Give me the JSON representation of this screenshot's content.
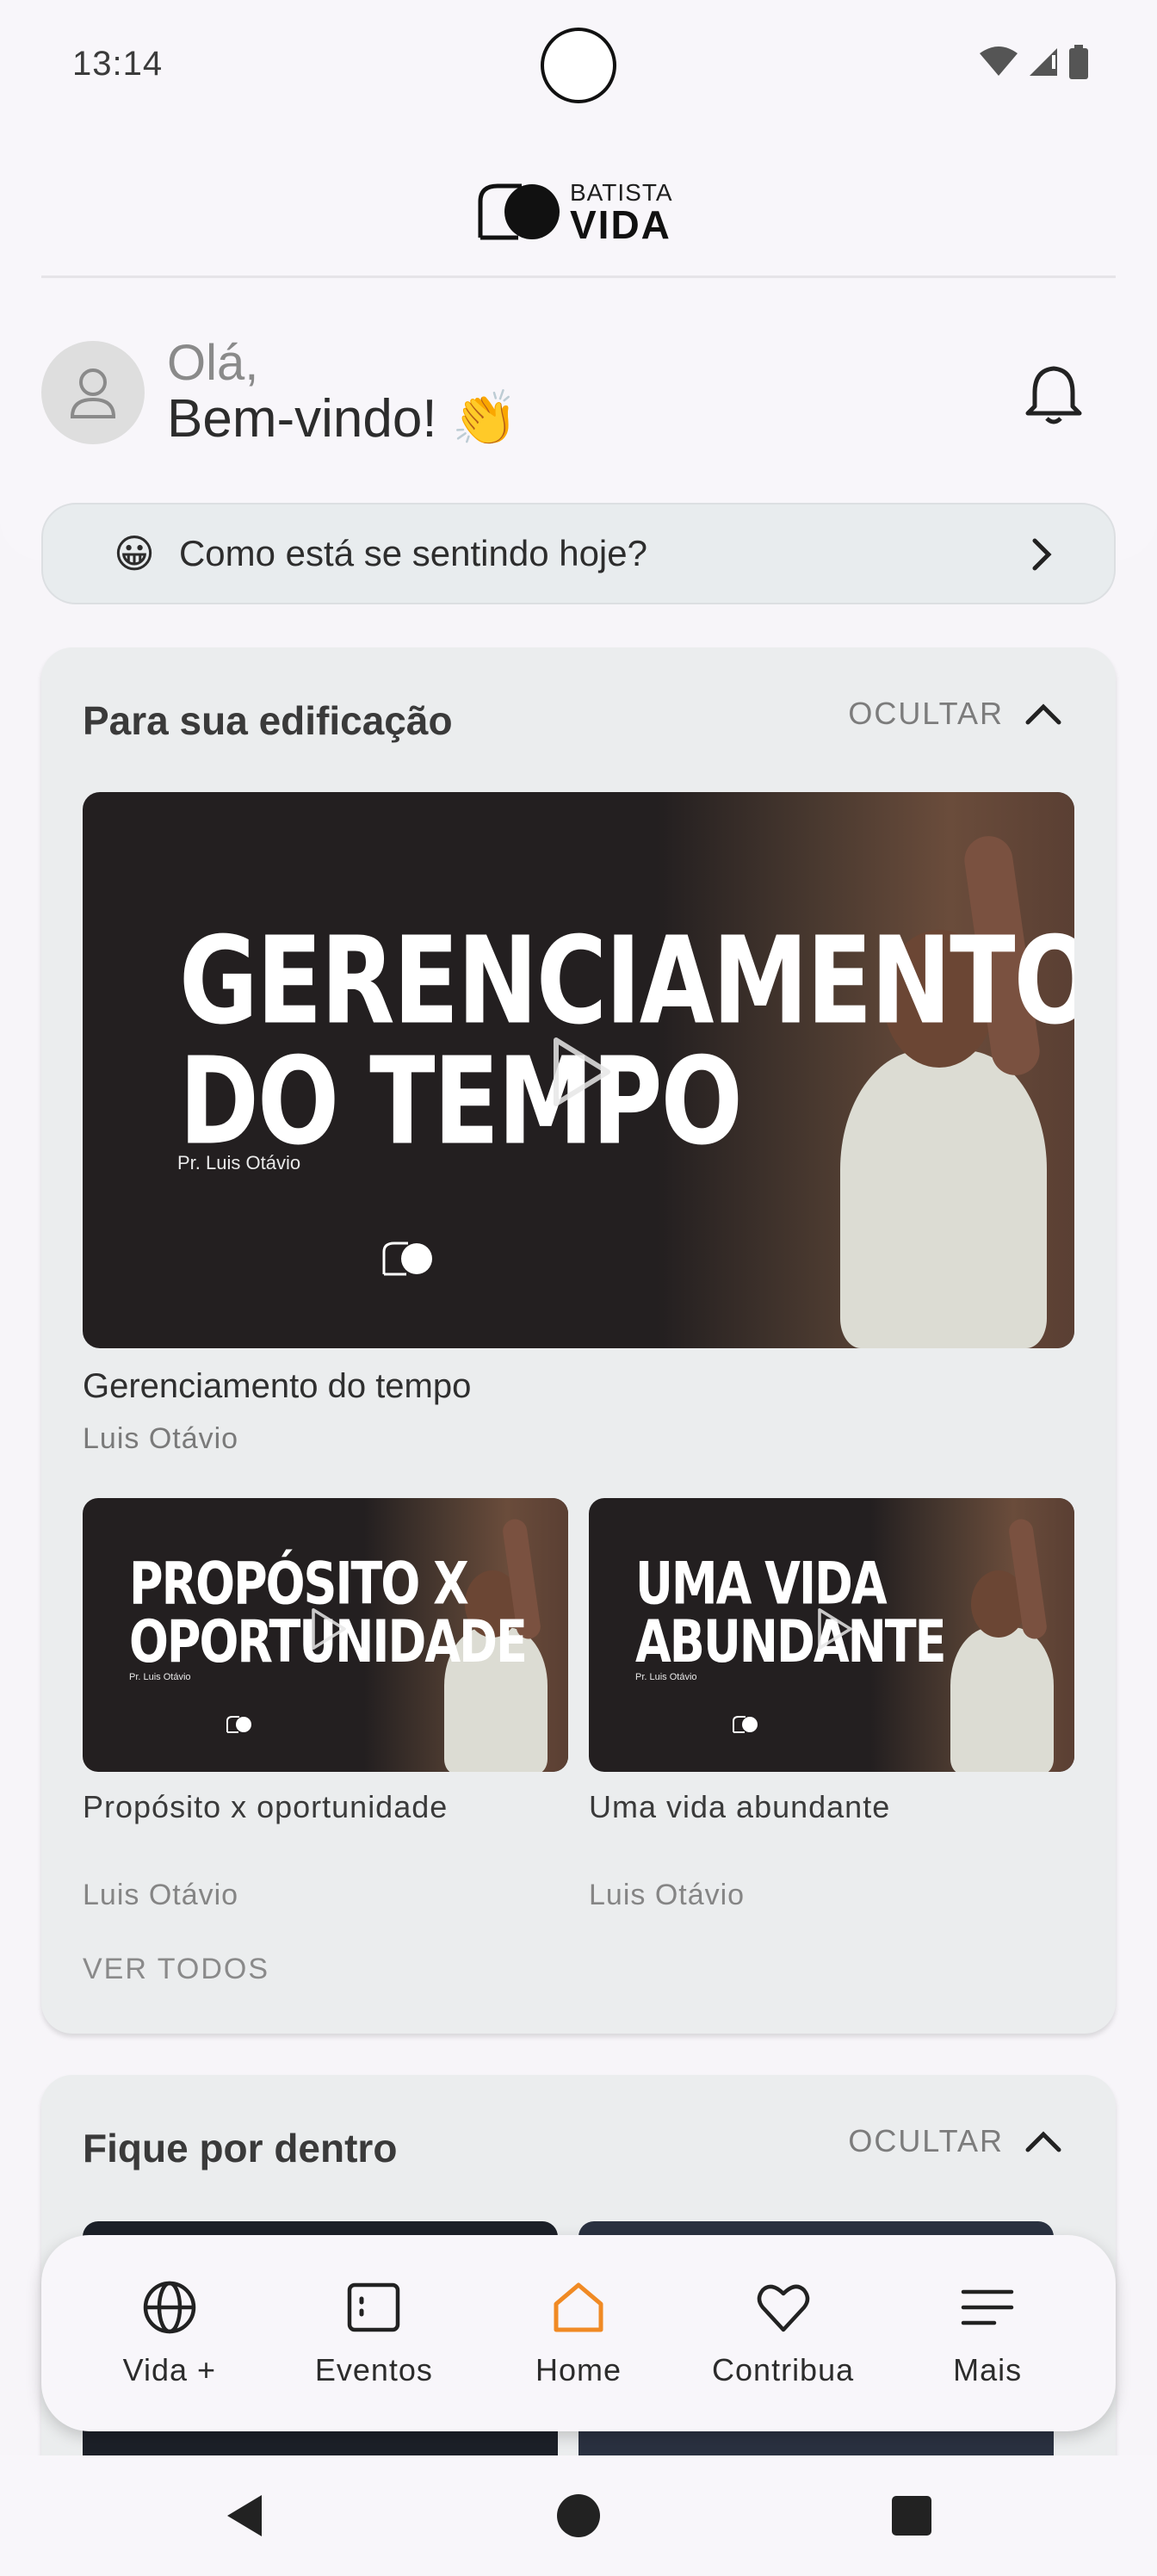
{
  "status_bar": {
    "time": "13:14"
  },
  "logo": {
    "line1": "BATISTA",
    "line2": "VIDA"
  },
  "greeting": {
    "line1": "Olá,",
    "line2": "Bem-vindo! 👏"
  },
  "mood": {
    "emoji": "😀",
    "text": "Como está se sentindo hoje?"
  },
  "edification": {
    "title": "Para sua edificação",
    "hide_label": "OCULTAR",
    "featured": {
      "thumb_title_line1": "GERENCIAMENTO",
      "thumb_title_line2": "DO TEMPO",
      "thumb_author": "Pr. Luis Otávio",
      "title": "Gerenciamento do tempo",
      "author": "Luis Otávio"
    },
    "items": [
      {
        "thumb_title_line1": "PROPÓSITO X",
        "thumb_title_line2": "OPORTUNIDADE",
        "thumb_author": "Pr. Luis Otávio",
        "title": "Propósito x oportunidade",
        "author": "Luis Otávio"
      },
      {
        "thumb_title_line1": "UMA VIDA",
        "thumb_title_line2": "ABUNDANTE",
        "thumb_author": "Pr. Luis Otávio",
        "title": "Uma vida abundante",
        "author": "Luis Otávio"
      }
    ],
    "see_all": "VER TODOS"
  },
  "news": {
    "title": "Fique por dentro",
    "hide_label": "OCULTAR"
  },
  "bottom_nav": [
    {
      "label": "Vida +",
      "icon": "globe-icon"
    },
    {
      "label": "Eventos",
      "icon": "calendar-icon"
    },
    {
      "label": "Home",
      "icon": "home-icon",
      "active": true
    },
    {
      "label": "Contribua",
      "icon": "heart-icon"
    },
    {
      "label": "Mais",
      "icon": "menu-icon"
    }
  ],
  "colors": {
    "accent": "#f08a24",
    "card_bg": "#ebedee",
    "thumb_bg": "#231f20"
  }
}
